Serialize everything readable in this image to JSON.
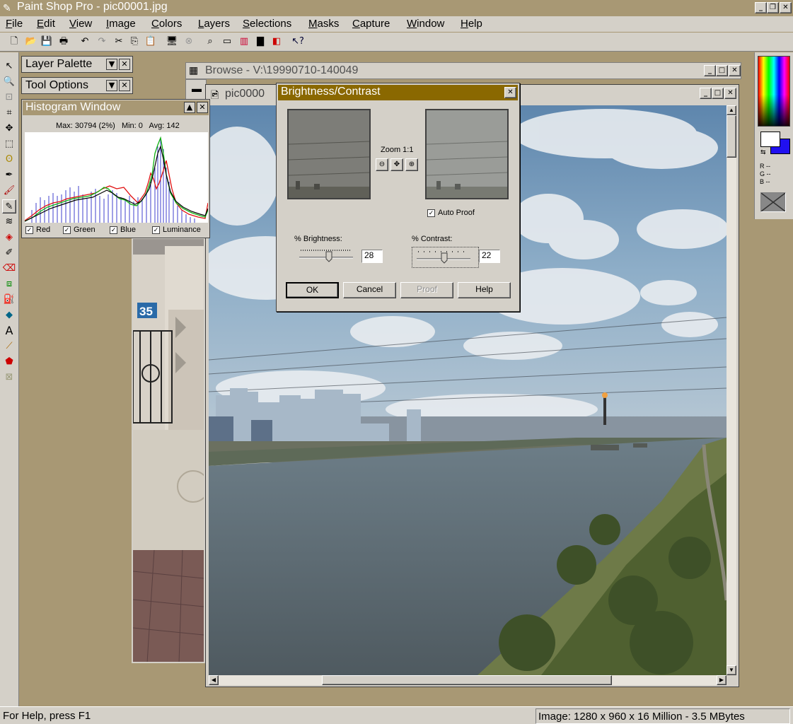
{
  "app": {
    "title": "Paint Shop Pro - pic00001.jpg",
    "window_buttons": [
      "_",
      "❐",
      "✕"
    ]
  },
  "menu": [
    {
      "label": "File",
      "u": "F",
      "rest": "ile"
    },
    {
      "label": "Edit",
      "u": "E",
      "rest": "dit"
    },
    {
      "label": "View",
      "u": "V",
      "rest": "iew"
    },
    {
      "label": "Image",
      "u": "I",
      "rest": "mage"
    },
    {
      "label": "Colors",
      "u": "C",
      "rest": "olors"
    },
    {
      "label": "Layers",
      "u": "L",
      "rest": "ayers"
    },
    {
      "label": "Selections",
      "u": "S",
      "rest": "elections"
    },
    {
      "label": "Masks",
      "u": "M",
      "rest": "asks"
    },
    {
      "label": "Capture",
      "u": "C",
      "rest": "apture"
    },
    {
      "label": "Window",
      "u": "W",
      "rest": "indow"
    },
    {
      "label": "Help",
      "u": "H",
      "rest": "elp"
    }
  ],
  "palettes": {
    "layer": "Layer Palette",
    "tool_options": "Tool Options",
    "histogram": {
      "title": "Histogram Window",
      "max": "Max: 30794 (2%)",
      "min": "Min: 0",
      "avg": "Avg: 142",
      "channels": [
        "Red",
        "Green",
        "Blue",
        "Luminance"
      ]
    }
  },
  "browse": {
    "title": "Browse - V:\\19990710-140049"
  },
  "image_window": {
    "title": "pic0000"
  },
  "dialog": {
    "title": "Brightness/Contrast",
    "zoom_label": "Zoom 1:1",
    "auto_proof": "Auto Proof",
    "brightness_label": "% Brightness:",
    "brightness_value": "28",
    "contrast_label": "% Contrast:",
    "contrast_value": "22",
    "buttons": {
      "ok": "OK",
      "cancel": "Cancel",
      "proof": "Proof",
      "help": "Help"
    }
  },
  "color_readout": [
    "R --",
    "G --",
    "B --"
  ],
  "status": {
    "left": "For Help, press F1",
    "right": "Image:  1280 x 960 x 16 Million - 3.5 MBytes"
  },
  "colors": {
    "title_bar": "#a89874",
    "dialog_title": "#8a6800",
    "face": "#d4d0c8",
    "fg_swatch": "#ffffff",
    "bg_swatch": "#2010f0"
  }
}
